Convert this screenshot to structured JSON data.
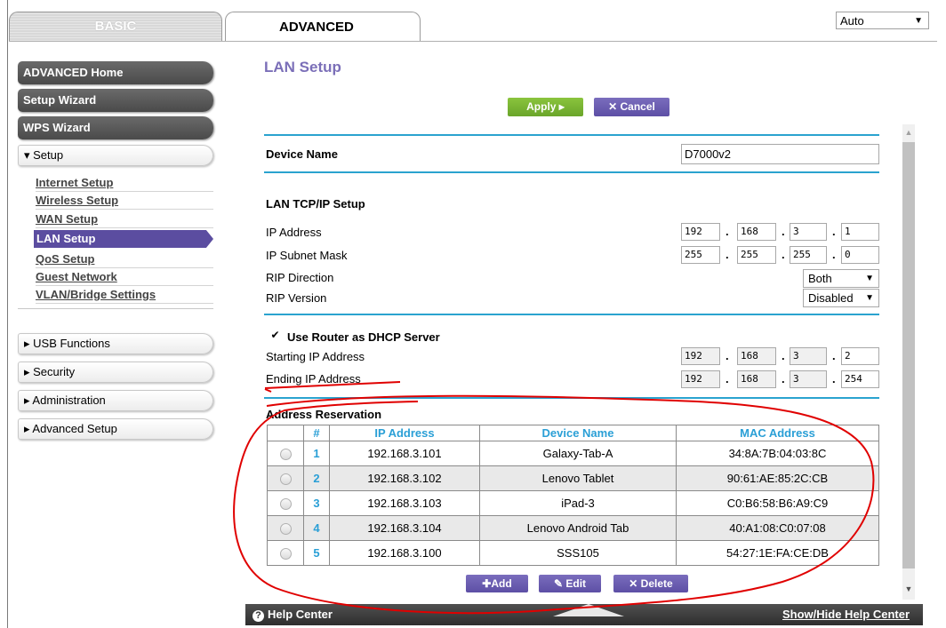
{
  "tabs": {
    "basic": "BASIC",
    "advanced": "ADVANCED"
  },
  "language_select": {
    "value": "Auto"
  },
  "sidebar": {
    "dark_items": [
      "ADVANCED Home",
      "Setup Wizard",
      "WPS Wizard"
    ],
    "setup_header": "▾ Setup",
    "setup_links": [
      "Internet Setup",
      "Wireless Setup",
      "WAN Setup",
      "LAN Setup",
      "QoS Setup",
      "Guest Network",
      "VLAN/Bridge Settings"
    ],
    "active_link": "LAN Setup",
    "sections": [
      "▸ USB Functions",
      "▸ Security",
      "▸ Administration",
      "▸ Advanced Setup"
    ]
  },
  "page": {
    "title": "LAN Setup",
    "apply_label": "Apply ▸",
    "cancel_label": "✕ Cancel",
    "device_name_label": "Device Name",
    "device_name_value": "D7000v2",
    "tcpip_heading": "LAN TCP/IP Setup",
    "ip_label": "IP Address",
    "ip_value": [
      "192",
      "168",
      "3",
      "1"
    ],
    "mask_label": "IP Subnet Mask",
    "mask_value": [
      "255",
      "255",
      "255",
      "0"
    ],
    "rip_dir_label": "RIP Direction",
    "rip_dir_value": "Both",
    "rip_ver_label": "RIP Version",
    "rip_ver_value": "Disabled",
    "dhcp_label": "Use Router as DHCP Server",
    "dhcp_checked": true,
    "start_ip_label": "Starting IP Address",
    "start_ip_value": [
      "192",
      "168",
      "3",
      "2"
    ],
    "end_ip_label": "Ending IP Address",
    "end_ip_value": [
      "192",
      "168",
      "3",
      "254"
    ],
    "reservation_heading": "Address Reservation"
  },
  "table": {
    "headers": [
      "#",
      "IP Address",
      "Device Name",
      "MAC Address"
    ],
    "rows": [
      {
        "num": "1",
        "ip": "192.168.3.101",
        "name": "Galaxy-Tab-A",
        "mac": "34:8A:7B:04:03:8C"
      },
      {
        "num": "2",
        "ip": "192.168.3.102",
        "name": "Lenovo Tablet",
        "mac": "90:61:AE:85:2C:CB"
      },
      {
        "num": "3",
        "ip": "192.168.3.103",
        "name": "iPad-3",
        "mac": "C0:B6:58:B6:A9:C9"
      },
      {
        "num": "4",
        "ip": "192.168.3.104",
        "name": "Lenovo Android Tab",
        "mac": "40:A1:08:C0:07:08"
      },
      {
        "num": "5",
        "ip": "192.168.3.100",
        "name": "SSS105",
        "mac": "54:27:1E:FA:CE:DB"
      }
    ],
    "add_label": "Add",
    "edit_label": "Edit",
    "delete_label": "Delete"
  },
  "help": {
    "left_label": "Help Center",
    "right_label": "Show/Hide Help Center"
  },
  "colors": {
    "accent_purple": "#5b4da0",
    "title_purple": "#7b6fb8",
    "teal": "#2aa3cf",
    "apply_green": "#7ab535",
    "annotation_red": "#e00000"
  }
}
